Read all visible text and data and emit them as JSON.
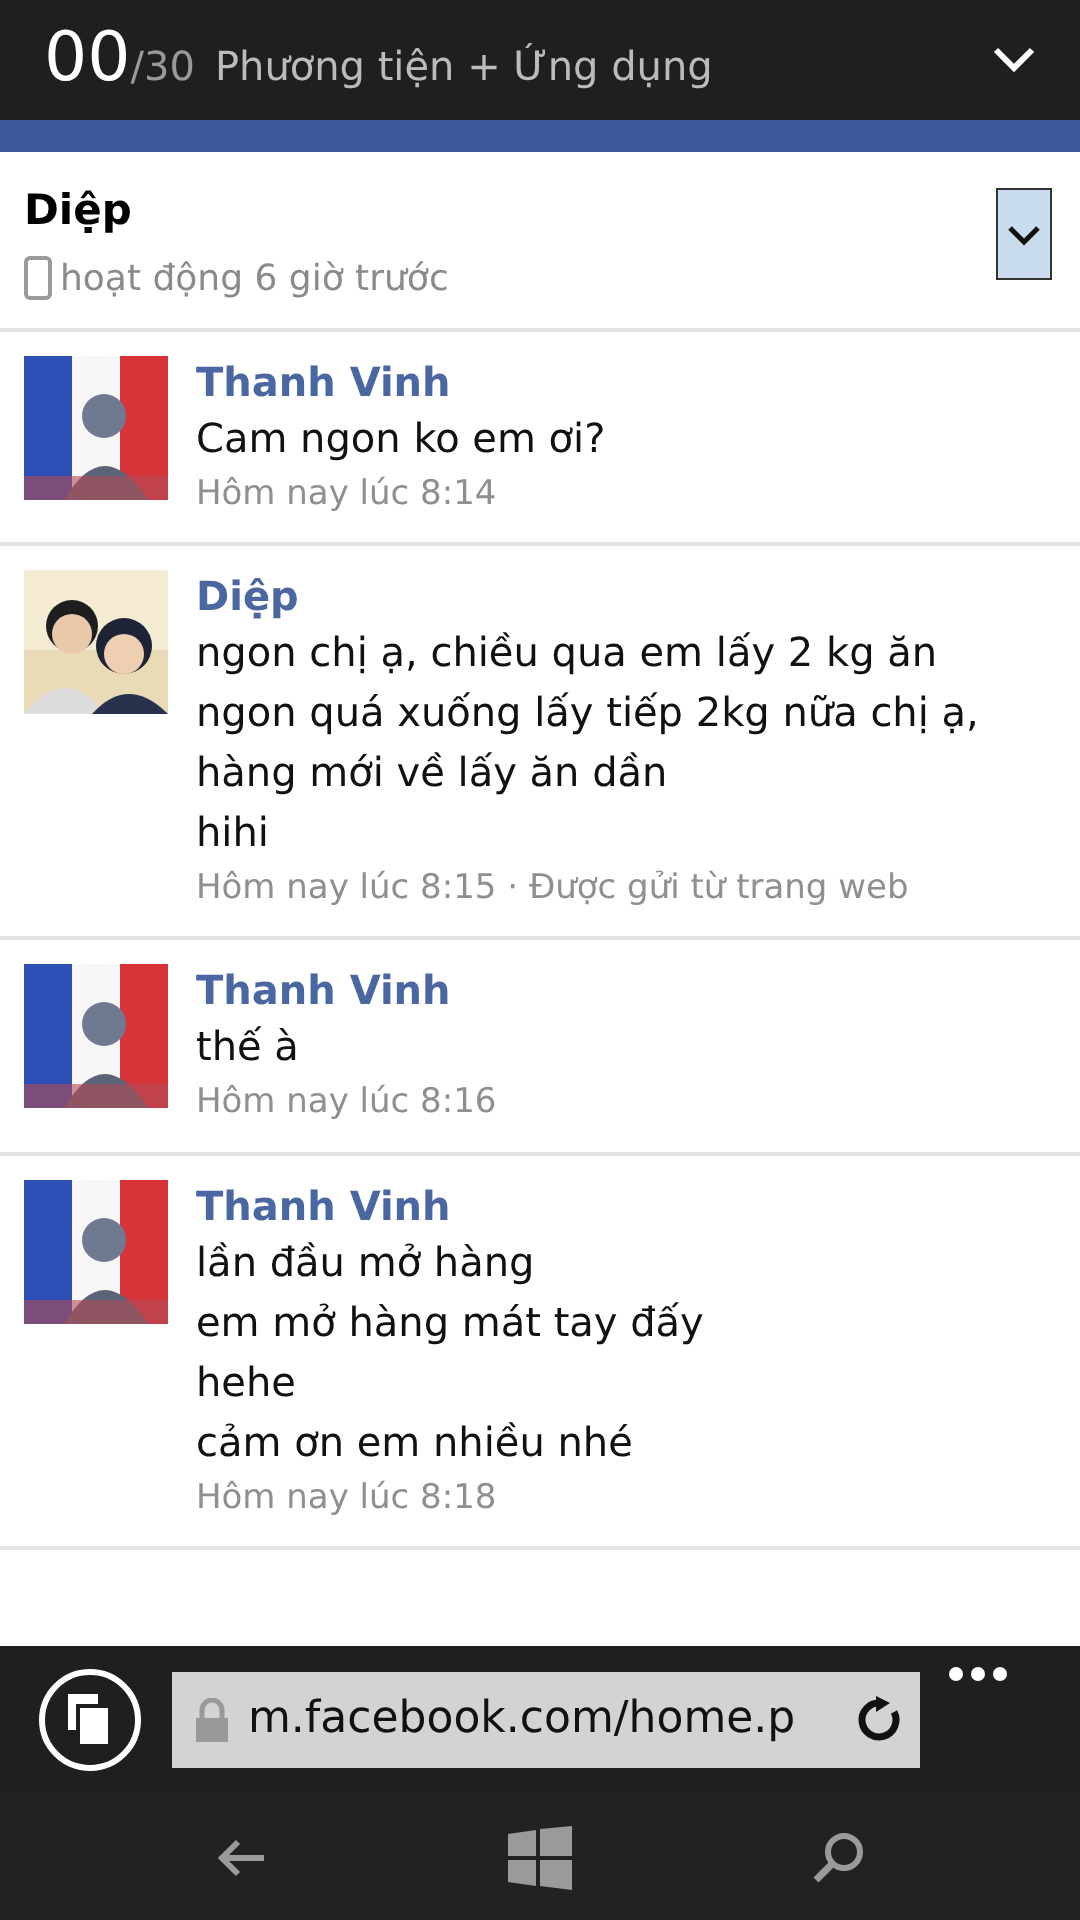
{
  "top_bar": {
    "count": "00",
    "total": "/30",
    "title": "Phương tiện + Ứng dụng"
  },
  "chat_header": {
    "name": "Diệp",
    "status": "hoạt động 6 giờ trước"
  },
  "messages": [
    {
      "sender": "Thanh Vinh",
      "lines": [
        "Cam ngon ko em ơi?"
      ],
      "time": "Hôm nay lúc 8:14"
    },
    {
      "sender": "Diệp",
      "lines": [
        "ngon chị ạ, chiều qua em lấy 2 kg ăn",
        "ngon quá xuống lấy tiếp 2kg nữa chị ạ,",
        "hàng mới về lấy ăn dần",
        "hihi"
      ],
      "time": "Hôm nay lúc 8:15 · Được gửi từ trang web"
    },
    {
      "sender": "Thanh Vinh",
      "lines": [
        "thế à"
      ],
      "time": "Hôm nay lúc 8:16"
    },
    {
      "sender": "Thanh Vinh",
      "lines": [
        "lần đầu mở hàng",
        "em mở hàng mát tay đấy",
        "hehe",
        "cảm ơn em nhiều nhé"
      ],
      "time": "Hôm nay lúc 8:18"
    }
  ],
  "address_bar": {
    "url": "m.facebook.com/home.p"
  }
}
